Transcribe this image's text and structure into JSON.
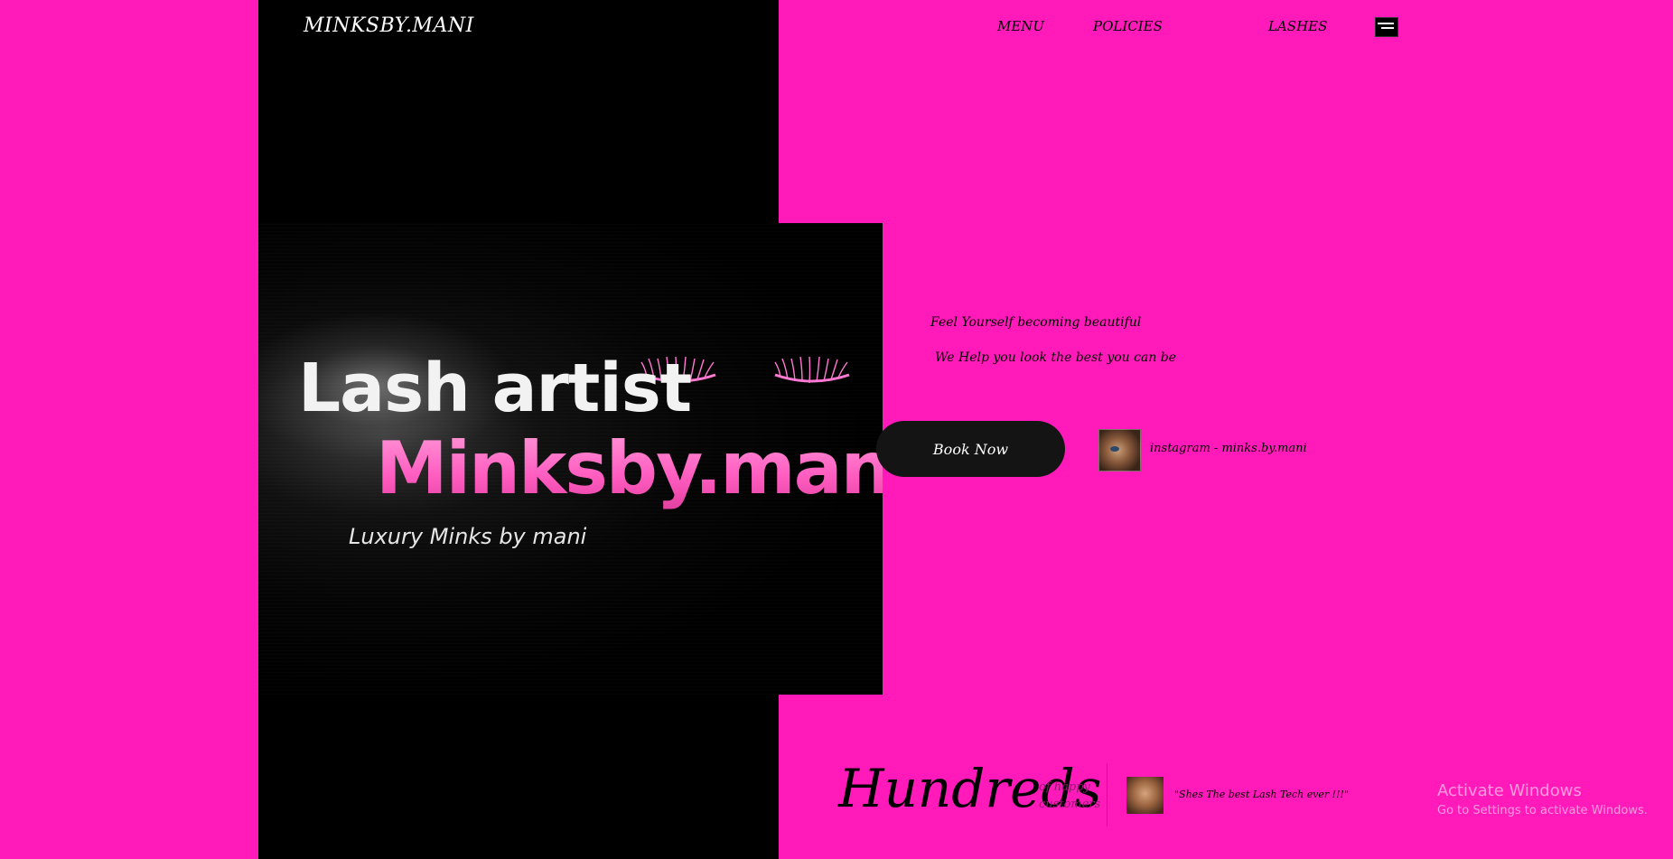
{
  "header": {
    "site_title": "MINKSBY.MANI",
    "nav": {
      "menu": "MENU",
      "policies": "POLICIES",
      "lashes": "LASHES"
    }
  },
  "hero": {
    "line1": "Lash artist",
    "line2": "Minksby.mani",
    "tagline": "Luxury Minks by mani"
  },
  "intro": {
    "tagline1": "Feel Yourself becoming beautiful",
    "tagline2": "We Help you look the best you can be"
  },
  "cta": {
    "book_now": "Book Now"
  },
  "social": {
    "instagram": "instagram - minks.by.mani"
  },
  "stats": {
    "headline": "Hundreds",
    "sub_line1": "of happy",
    "sub_line2": "customers",
    "review": "\"Shes The best Lash Tech ever !!!\""
  },
  "watermark": {
    "line1": "Activate Windows",
    "line2": "Go to Settings to activate Windows."
  },
  "colors": {
    "background": "#ff1ab9",
    "panel": "#000000",
    "button": "#141414",
    "accent_pink": "#ff6ec7"
  }
}
